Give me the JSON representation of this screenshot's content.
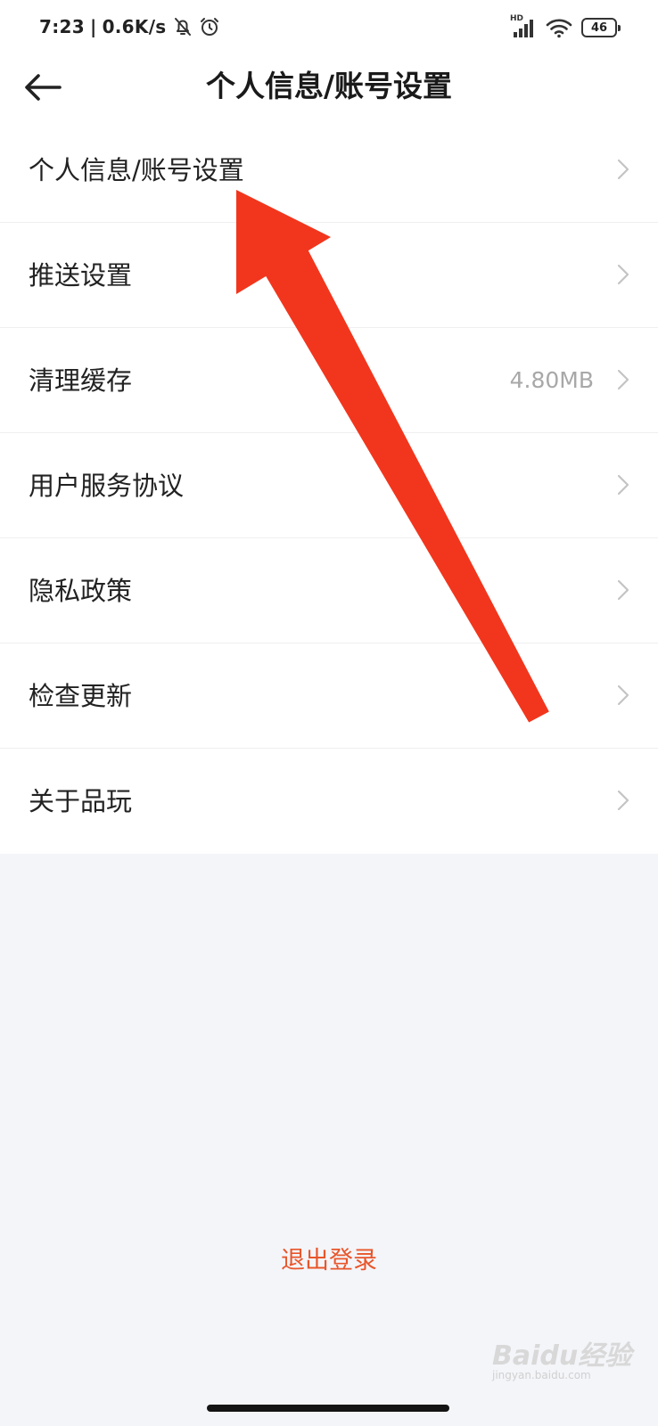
{
  "status_bar": {
    "time": "7:23",
    "separator": "|",
    "network_speed": "0.6K/s",
    "battery_level": "46",
    "hd_label": "HD",
    "icons": [
      "bell-off-icon",
      "alarm-icon",
      "signal-icon",
      "wifi-icon",
      "battery-icon"
    ]
  },
  "header": {
    "back_icon": "arrow-left-icon",
    "title": "个人信息/账号设置"
  },
  "menu": {
    "items": [
      {
        "label": "个人信息/账号设置",
        "value": ""
      },
      {
        "label": "推送设置",
        "value": ""
      },
      {
        "label": "清理缓存",
        "value": "4.80MB"
      },
      {
        "label": "用户服务协议",
        "value": ""
      },
      {
        "label": "隐私政策",
        "value": ""
      },
      {
        "label": "检查更新",
        "value": ""
      },
      {
        "label": "关于品玩",
        "value": ""
      }
    ]
  },
  "logout_label": "退出登录",
  "watermark": {
    "text": "Baidu经验",
    "sub": "jingyan.baidu.com"
  },
  "colors": {
    "accent": "#e8562b",
    "annotation_arrow": "#f2361d",
    "page_background": "#f4f5f9",
    "value_text": "#a8a8a8"
  }
}
